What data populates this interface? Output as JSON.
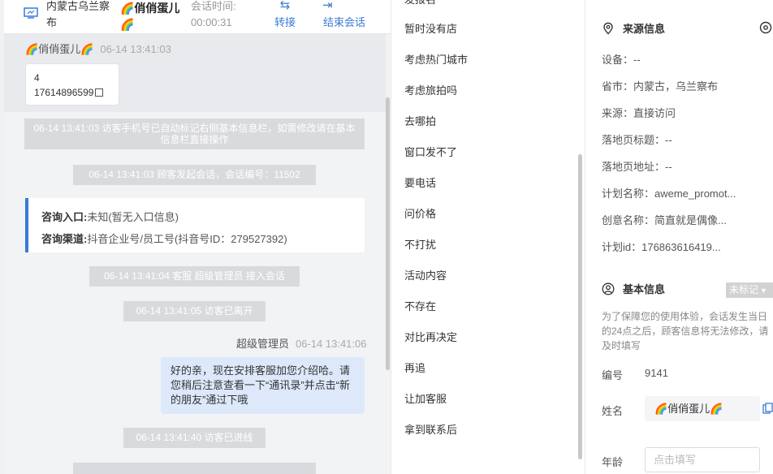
{
  "header": {
    "location": "内蒙古乌兰察布",
    "visitor_name": "🌈俏俏蛋儿🌈",
    "session_time_label": "会话时间:",
    "session_time_value": "00:00:31",
    "transfer_label": "转接",
    "end_label": "结束会话"
  },
  "chat": {
    "visitor_sender": "🌈俏俏蛋儿🌈",
    "visitor_ts": "06-14 13:41:03",
    "visitor_msg_line1": "4",
    "visitor_msg_line2": "17614896599",
    "sys1": "06-14 13:41:03 访客手机号已自动标记右侧基本信息栏，如需修改请在基本信息栏直接操作",
    "sys2": "06-14 13:41:03 顾客发起会话，会话编号：11502",
    "entry_label": "咨询入口:",
    "entry_value": "未知(暂无入口信息)",
    "channel_label": "咨询渠道:",
    "channel_value": "抖音企业号/员工号(抖音号ID：279527392)",
    "sys3": "06-14 13:41:04 客服 超级管理员 接入会话",
    "sys4": "06-14 13:41:05 访客已离开",
    "agent_sender": "超级管理员",
    "agent_ts": "06-14 13:41:06",
    "agent_msg": "好的亲，现在安排客服加您介绍哈。请您稍后注意查看一下“通讯录”并点击“新的朋友”通过下哦",
    "sys5": "06-14 13:41:40 访客已进线"
  },
  "quick_replies": {
    "partial_top": "发报名",
    "items": [
      "暂时没有店",
      "考虑热门城市",
      "考虑旅拍吗",
      "去哪拍",
      "窗口发不了",
      "要电话",
      "问价格",
      "不打扰",
      "活动内容",
      "不存在",
      "对比再决定",
      "再追",
      "让加客服",
      "拿到联系后"
    ]
  },
  "side": {
    "source_title": "来源信息",
    "device": "设备：--",
    "province": "省市：内蒙古，乌兰察布",
    "source": "来源：直接访问",
    "landing_title": "落地页标题：--",
    "landing_url": "落地页地址：--",
    "plan_name": "计划名称：aweme_promot...",
    "creative_name": "创意名称：简直就是偶像...",
    "plan_id": "计划id：176863616419...",
    "basic_title": "基本信息",
    "unmarked_tag": "未标记",
    "notice": "为了保障您的使用体验，会话发生当日的24点之后，顾客信息将无法修改，请及时填写",
    "number_label": "编号",
    "number_value": "9141",
    "name_label": "姓名",
    "name_value": "🌈俏俏蛋儿🌈",
    "age_label": "年龄",
    "age_placeholder": "点击填写"
  },
  "colors": {
    "accent": "#3a7bd5",
    "system_msg_bg": "#d9dadd",
    "agent_bubble": "#dde9fb"
  }
}
